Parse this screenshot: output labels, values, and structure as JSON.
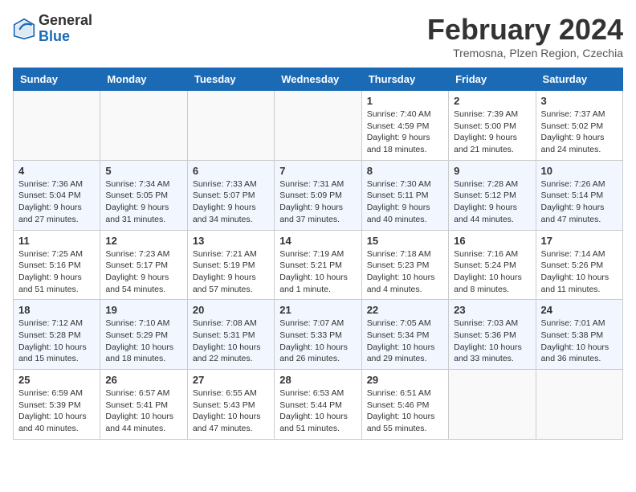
{
  "header": {
    "logo_general": "General",
    "logo_blue": "Blue",
    "month_title": "February 2024",
    "location": "Tremosna, Plzen Region, Czechia"
  },
  "weekdays": [
    "Sunday",
    "Monday",
    "Tuesday",
    "Wednesday",
    "Thursday",
    "Friday",
    "Saturday"
  ],
  "weeks": [
    [
      {
        "day": "",
        "info": ""
      },
      {
        "day": "",
        "info": ""
      },
      {
        "day": "",
        "info": ""
      },
      {
        "day": "",
        "info": ""
      },
      {
        "day": "1",
        "info": "Sunrise: 7:40 AM\nSunset: 4:59 PM\nDaylight: 9 hours\nand 18 minutes."
      },
      {
        "day": "2",
        "info": "Sunrise: 7:39 AM\nSunset: 5:00 PM\nDaylight: 9 hours\nand 21 minutes."
      },
      {
        "day": "3",
        "info": "Sunrise: 7:37 AM\nSunset: 5:02 PM\nDaylight: 9 hours\nand 24 minutes."
      }
    ],
    [
      {
        "day": "4",
        "info": "Sunrise: 7:36 AM\nSunset: 5:04 PM\nDaylight: 9 hours\nand 27 minutes."
      },
      {
        "day": "5",
        "info": "Sunrise: 7:34 AM\nSunset: 5:05 PM\nDaylight: 9 hours\nand 31 minutes."
      },
      {
        "day": "6",
        "info": "Sunrise: 7:33 AM\nSunset: 5:07 PM\nDaylight: 9 hours\nand 34 minutes."
      },
      {
        "day": "7",
        "info": "Sunrise: 7:31 AM\nSunset: 5:09 PM\nDaylight: 9 hours\nand 37 minutes."
      },
      {
        "day": "8",
        "info": "Sunrise: 7:30 AM\nSunset: 5:11 PM\nDaylight: 9 hours\nand 40 minutes."
      },
      {
        "day": "9",
        "info": "Sunrise: 7:28 AM\nSunset: 5:12 PM\nDaylight: 9 hours\nand 44 minutes."
      },
      {
        "day": "10",
        "info": "Sunrise: 7:26 AM\nSunset: 5:14 PM\nDaylight: 9 hours\nand 47 minutes."
      }
    ],
    [
      {
        "day": "11",
        "info": "Sunrise: 7:25 AM\nSunset: 5:16 PM\nDaylight: 9 hours\nand 51 minutes."
      },
      {
        "day": "12",
        "info": "Sunrise: 7:23 AM\nSunset: 5:17 PM\nDaylight: 9 hours\nand 54 minutes."
      },
      {
        "day": "13",
        "info": "Sunrise: 7:21 AM\nSunset: 5:19 PM\nDaylight: 9 hours\nand 57 minutes."
      },
      {
        "day": "14",
        "info": "Sunrise: 7:19 AM\nSunset: 5:21 PM\nDaylight: 10 hours\nand 1 minute."
      },
      {
        "day": "15",
        "info": "Sunrise: 7:18 AM\nSunset: 5:23 PM\nDaylight: 10 hours\nand 4 minutes."
      },
      {
        "day": "16",
        "info": "Sunrise: 7:16 AM\nSunset: 5:24 PM\nDaylight: 10 hours\nand 8 minutes."
      },
      {
        "day": "17",
        "info": "Sunrise: 7:14 AM\nSunset: 5:26 PM\nDaylight: 10 hours\nand 11 minutes."
      }
    ],
    [
      {
        "day": "18",
        "info": "Sunrise: 7:12 AM\nSunset: 5:28 PM\nDaylight: 10 hours\nand 15 minutes."
      },
      {
        "day": "19",
        "info": "Sunrise: 7:10 AM\nSunset: 5:29 PM\nDaylight: 10 hours\nand 18 minutes."
      },
      {
        "day": "20",
        "info": "Sunrise: 7:08 AM\nSunset: 5:31 PM\nDaylight: 10 hours\nand 22 minutes."
      },
      {
        "day": "21",
        "info": "Sunrise: 7:07 AM\nSunset: 5:33 PM\nDaylight: 10 hours\nand 26 minutes."
      },
      {
        "day": "22",
        "info": "Sunrise: 7:05 AM\nSunset: 5:34 PM\nDaylight: 10 hours\nand 29 minutes."
      },
      {
        "day": "23",
        "info": "Sunrise: 7:03 AM\nSunset: 5:36 PM\nDaylight: 10 hours\nand 33 minutes."
      },
      {
        "day": "24",
        "info": "Sunrise: 7:01 AM\nSunset: 5:38 PM\nDaylight: 10 hours\nand 36 minutes."
      }
    ],
    [
      {
        "day": "25",
        "info": "Sunrise: 6:59 AM\nSunset: 5:39 PM\nDaylight: 10 hours\nand 40 minutes."
      },
      {
        "day": "26",
        "info": "Sunrise: 6:57 AM\nSunset: 5:41 PM\nDaylight: 10 hours\nand 44 minutes."
      },
      {
        "day": "27",
        "info": "Sunrise: 6:55 AM\nSunset: 5:43 PM\nDaylight: 10 hours\nand 47 minutes."
      },
      {
        "day": "28",
        "info": "Sunrise: 6:53 AM\nSunset: 5:44 PM\nDaylight: 10 hours\nand 51 minutes."
      },
      {
        "day": "29",
        "info": "Sunrise: 6:51 AM\nSunset: 5:46 PM\nDaylight: 10 hours\nand 55 minutes."
      },
      {
        "day": "",
        "info": ""
      },
      {
        "day": "",
        "info": ""
      }
    ]
  ]
}
